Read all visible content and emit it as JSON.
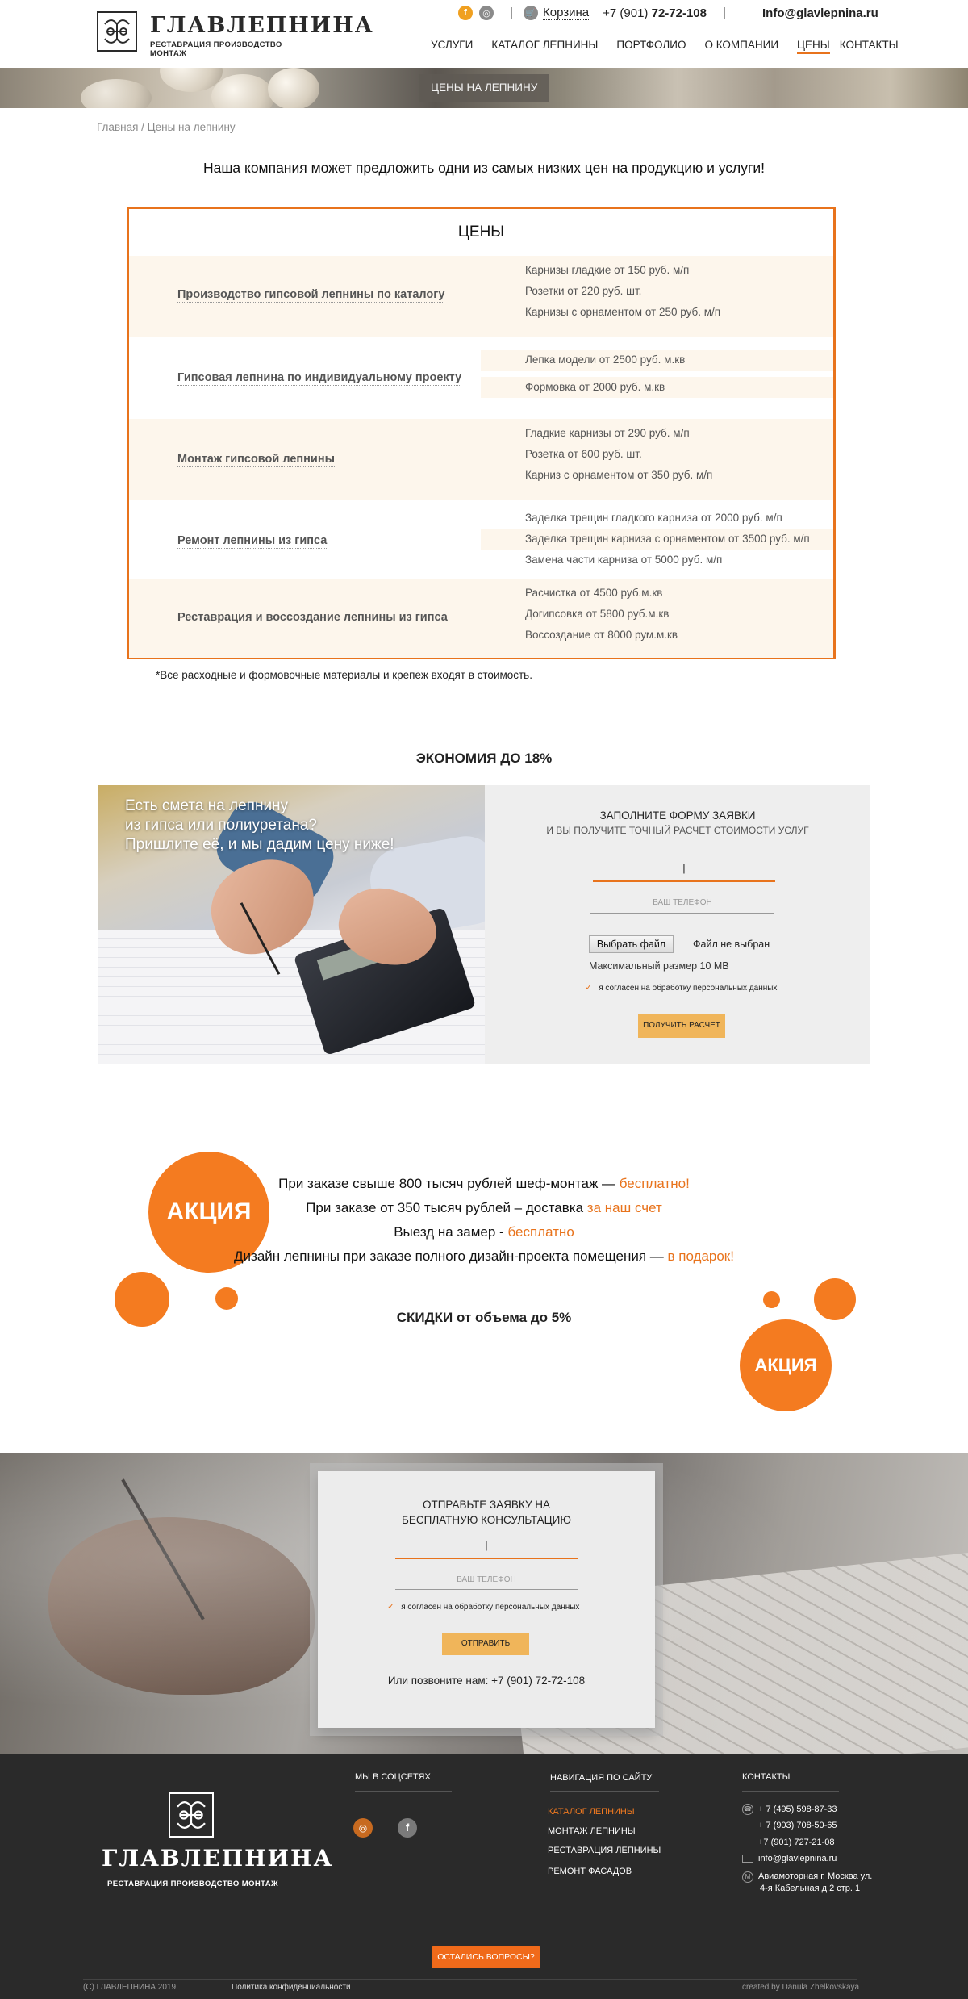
{
  "header": {
    "logo_word": "ГЛАВЛЕПНИНА",
    "logo_sub": "РЕСТАВРАЦИЯ ПРОИЗВОДСТВО МОНТАЖ",
    "social": [
      "facebook-icon",
      "instagram-icon"
    ],
    "cart_label": "Корзина",
    "phone_prefix": "+7 (901) ",
    "phone_main": "72-72-108",
    "email": "Info@glavlepnina.ru",
    "nav": [
      "Услуги",
      "Каталог лепнины",
      "Портфолио",
      "О компании",
      "Цены",
      "Контакты"
    ],
    "active_nav": "Цены"
  },
  "banner": {
    "label": "ЦЕНЫ НА ЛЕПНИНУ"
  },
  "breadcrumb": {
    "home": "Главная",
    "sep": " / ",
    "current": "Цены на лепнину"
  },
  "intro": "Наша компания может предложить одни из самых низких цен на продукцию и услуги!",
  "prices": {
    "title": "ЦЕНЫ",
    "rows": [
      {
        "label": "Производство гипсовой лепнины по каталогу",
        "items": [
          "Карнизы гладкие от 150 руб. м/п",
          "Розетки от 220 руб. шт.",
          "Карнизы с орнаментом от 250 руб. м/п"
        ]
      },
      {
        "label": "Гипсовая лепнина по индивидуальному проекту",
        "items": [
          "Лепка модели от 2500 руб. м.кв",
          "Формовка от 2000 руб. м.кв"
        ]
      },
      {
        "label": "Монтаж гипсовой лепнины",
        "items": [
          "Гладкие карнизы от 290 руб. м/п",
          "Розетка от 600 руб. шт.",
          "Карниз с орнаментом от 350 руб. м/п"
        ]
      },
      {
        "label": "Ремонт лепнины из гипса",
        "items": [
          "Заделка трещин гладкого карниза от 2000 руб. м/п",
          "Заделка трещин карниза с орнаментом от 3500 руб. м/п",
          "Замена части карниза от 5000 руб. м/п"
        ]
      },
      {
        "label": "Реставрация и воссоздание лепнины из гипса",
        "items": [
          "Расчистка от 4500 руб.м.кв",
          "Догипсовка от 5800 руб.м.кв",
          "Воссоздание от 8000 рум.м.кв"
        ]
      }
    ],
    "note": "*Все расходные и формовочные материалы и крепеж входят в стоимость."
  },
  "economy": {
    "title": "ЭКОНОМИЯ ДО 18%",
    "photo_text": [
      "Есть смета на лепнину",
      "из гипса или полиуретана?",
      "Пришлите её, и мы дадим цену ниже!"
    ],
    "form_title": "ЗАПОЛНИТЕ ФОРМУ ЗАЯВКИ",
    "form_subtitle": "И ВЫ ПОЛУЧИТЕ ТОЧНЫЙ РАСЧЕТ СТОИМОСТИ УСЛУГ",
    "name_value": "|",
    "phone_placeholder": "ВАШ ТЕЛЕФОН",
    "file_button": "Выбрать файл",
    "file_status": "Файл не выбран",
    "file_limit": "Максимальный размер 10 MB",
    "consent": "я согласен на обработку персональных данных",
    "submit": "ПОЛУЧИТЬ РАСЧЕТ"
  },
  "promo": {
    "badge": "АКЦИЯ",
    "lines": [
      {
        "text": "При заказе свыше 800 тысяч рублей шеф-монтаж — ",
        "highlight": "бесплатно!"
      },
      {
        "text": "При заказе от 350 тысяч рублей – доставка ",
        "highlight": "за наш счет"
      },
      {
        "text": "Выезд на замер - ",
        "highlight": "бесплатно"
      },
      {
        "text": "Дизайн лепнины при заказе полного дизайн-проекта помещения — ",
        "highlight": "в подарок!"
      }
    ],
    "discount": "СКИДКИ от объема до 5%",
    "accent": "#f47b20"
  },
  "consult": {
    "title_line1": "ОТПРАВЬТЕ ЗАЯВКУ НА",
    "title_line2": "БЕСПЛАТНУЮ КОНСУЛЬТАЦИЮ",
    "name_value": "|",
    "phone_placeholder": "ВАШ ТЕЛЕФОН",
    "consent": "я согласен на обработку персональных данных",
    "submit": "ОТПРАВИТЬ",
    "call_prefix": "Или позвоните нам: ",
    "call_phone": "+7 (901) 72-72-108"
  },
  "footer": {
    "logo_word": "ГЛАВЛЕПНИНА",
    "logo_sub": "РЕСТАВРАЦИЯ ПРОИЗВОДСТВО МОНТАЖ",
    "social_title": "МЫ В СОЦСЕТЯХ",
    "nav_title": "НАВИГАЦИЯ ПО САЙТУ",
    "nav": [
      "КАТАЛОГ ЛЕПНИНЫ",
      "МОНТАЖ ЛЕПНИНЫ",
      "РЕСТАВРАЦИЯ ЛЕПНИНЫ",
      "РЕМОНТ ФАСАДОВ"
    ],
    "contacts_title": "КОНТАКТЫ",
    "phones": [
      "+ 7 (495) 598-87-33",
      "+ 7 (903) 708-50-65",
      "+7 (901) 727-21-08"
    ],
    "email": "info@glavlepnina.ru",
    "address1": "Авиамоторная г. Москва ул.",
    "address2": "4-я Кабельная д.2 стр. 1",
    "question_button": "ОСТАЛИСЬ ВОПРОСЫ?",
    "copyright": "(С) ГЛАВЛЕПНИНА 2019",
    "policy": "Политика конфиденциальности",
    "credits": "created by Danula Zhelkovskaya"
  }
}
